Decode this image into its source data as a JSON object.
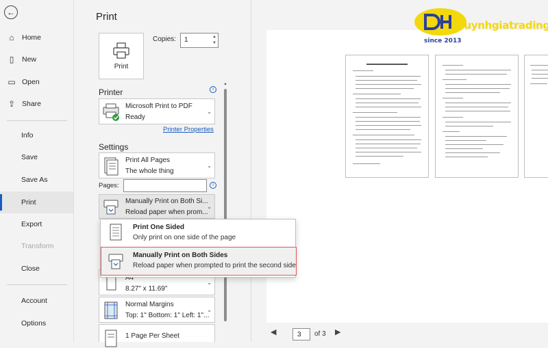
{
  "nav": {
    "items": [
      {
        "label": "Home",
        "icon": "home-icon"
      },
      {
        "label": "New",
        "icon": "new-document-icon"
      },
      {
        "label": "Open",
        "icon": "open-folder-icon"
      },
      {
        "label": "Share",
        "icon": "share-icon"
      },
      {
        "label": "Info"
      },
      {
        "label": "Save"
      },
      {
        "label": "Save As"
      },
      {
        "label": "Print"
      },
      {
        "label": "Export"
      },
      {
        "label": "Transform"
      },
      {
        "label": "Close"
      },
      {
        "label": "Account"
      },
      {
        "label": "Options"
      }
    ],
    "active": "Print",
    "disabled": "Transform"
  },
  "print": {
    "title": "Print",
    "print_button_label": "Print",
    "copies_label": "Copies:",
    "copies_value": "1"
  },
  "printer": {
    "section_label": "Printer",
    "name": "Microsoft Print to PDF",
    "status": "Ready",
    "properties_link": "Printer Properties"
  },
  "settings": {
    "section_label": "Settings",
    "pages_range": {
      "title": "Print All Pages",
      "desc": "The whole thing"
    },
    "pages_label": "Pages:",
    "pages_value": "",
    "sides": {
      "title": "Manually Print on Both Si...",
      "desc": "Reload paper when prom..."
    },
    "paper": {
      "title": "A4",
      "desc": "8.27\" x 11.69\""
    },
    "margins": {
      "title": "Normal Margins",
      "desc": "Top: 1\" Bottom: 1\" Left: 1\"..."
    },
    "per_sheet": {
      "title": "1 Page Per Sheet"
    }
  },
  "popup": {
    "options": [
      {
        "title": "Print One Sided",
        "desc": "Only print on one side of the page",
        "selected": false
      },
      {
        "title": "Manually Print on Both Sides",
        "desc": "Reload paper when prompted to print the second side",
        "selected": true
      }
    ]
  },
  "preview": {
    "current_page": "3",
    "of_text": "of 3"
  },
  "logo": {
    "name": "huynhgiatrading",
    "since": "since 2013"
  },
  "colors": {
    "accent": "#185abd",
    "highlight": "#e05656",
    "logo_yellow": "#f3d80c",
    "logo_blue": "#2b3f9e"
  }
}
